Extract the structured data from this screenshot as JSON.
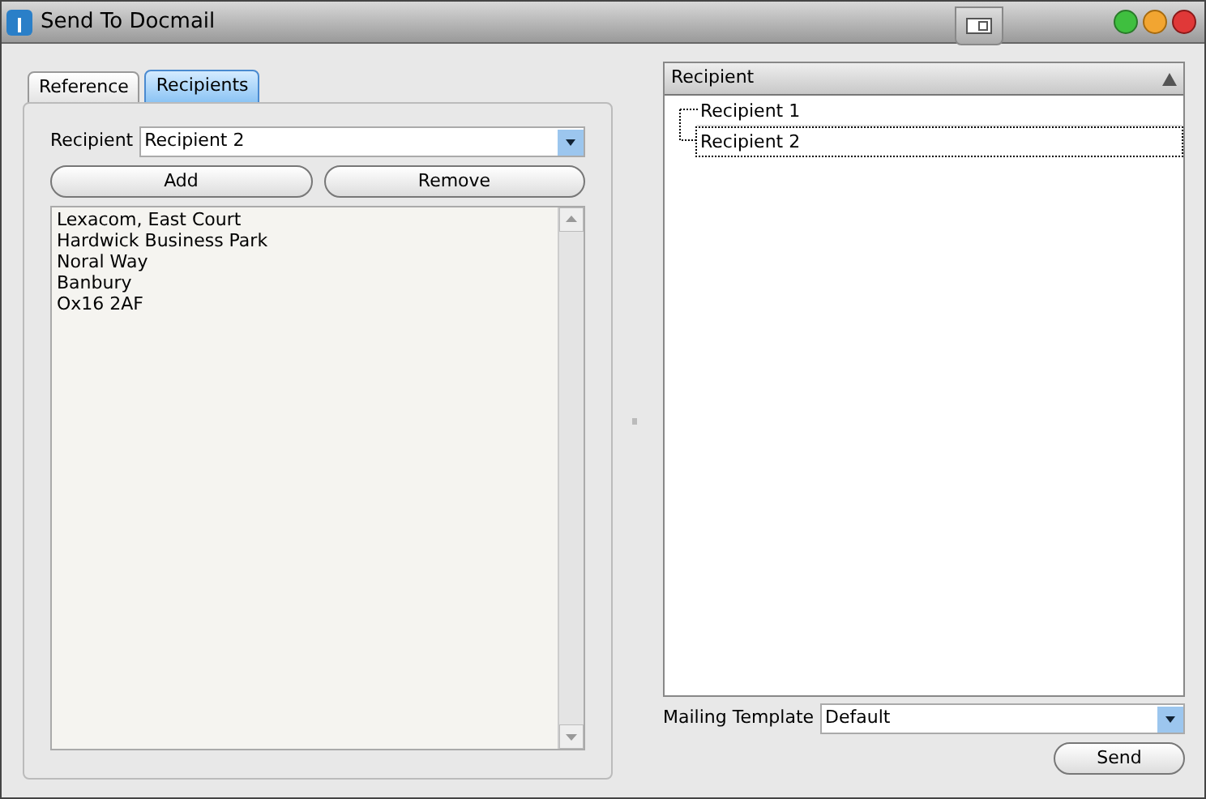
{
  "window": {
    "title": "Send To Docmail"
  },
  "tabs": [
    {
      "label": "Reference",
      "selected": false
    },
    {
      "label": "Recipients",
      "selected": true
    }
  ],
  "recipient_field": {
    "label": "Recipient",
    "value": "Recipient 2"
  },
  "buttons": [
    "Add",
    "Remove"
  ],
  "address_lines": [
    "Lexacom, East Court",
    "Hardwick Business Park",
    "Noral Way",
    "Banbury",
    "Ox16 2AF"
  ],
  "tree": {
    "column": "Recipient",
    "items": [
      {
        "label": "Recipient 1",
        "selected": false
      },
      {
        "label": "Recipient 2",
        "selected": true
      }
    ]
  },
  "mailing_template": {
    "label": "Mailing Template",
    "value": "Default"
  },
  "send_button": "Send"
}
